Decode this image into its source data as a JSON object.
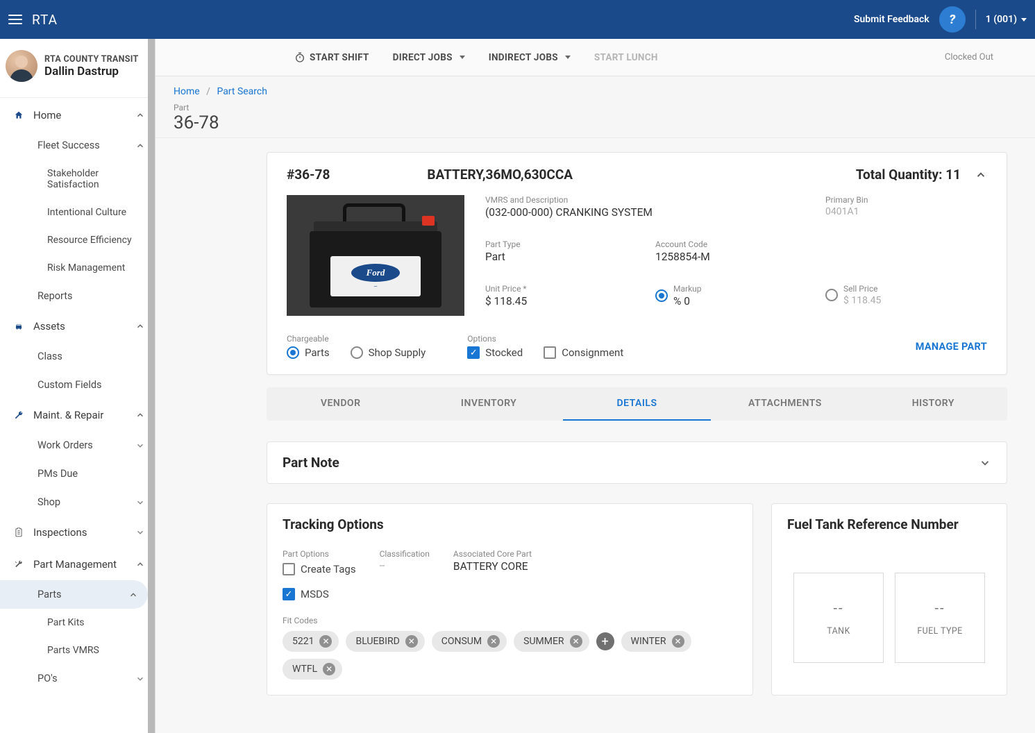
{
  "topbar": {
    "brand": "RTA",
    "feedback": "Submit Feedback",
    "user": "1 (001)"
  },
  "profile": {
    "org": "RTA COUNTY TRANSIT",
    "name": "Dallin Dastrup"
  },
  "sidebar": {
    "home": "Home",
    "fleet_success": "Fleet Success",
    "stakeholder": "Stakeholder Satisfaction",
    "intentional": "Intentional Culture",
    "resource": "Resource Efficiency",
    "risk": "Risk Management",
    "reports": "Reports",
    "assets": "Assets",
    "class": "Class",
    "custom_fields": "Custom Fields",
    "maint": "Maint. & Repair",
    "work_orders": "Work Orders",
    "pms_due": "PMs Due",
    "shop": "Shop",
    "inspections": "Inspections",
    "part_mgmt": "Part Management",
    "parts": "Parts",
    "part_kits": "Part Kits",
    "parts_vmrs": "Parts VMRS",
    "pos": "PO's"
  },
  "toolbar": {
    "start_shift": "START SHIFT",
    "direct_jobs": "DIRECT JOBS",
    "indirect_jobs": "INDIRECT JOBS",
    "start_lunch": "START LUNCH",
    "status": "Clocked Out"
  },
  "breadcrumb": {
    "home": "Home",
    "search": "Part Search"
  },
  "page": {
    "label": "Part",
    "title": "36-78"
  },
  "part": {
    "number": "#36-78",
    "title": "BATTERY,36MO,630CCA",
    "qty_label": "Total Quantity: ",
    "qty_value": "11",
    "vmrs_label": "VMRS and Description",
    "vmrs_value": "(032-000-000) CRANKING SYSTEM",
    "primary_bin_label": "Primary Bin",
    "primary_bin_value": "0401A1",
    "part_type_label": "Part Type",
    "part_type_value": "Part",
    "account_code_label": "Account Code",
    "account_code_value": "1258854-M",
    "unit_price_label": "Unit Price *",
    "unit_price_value": "$ 118.45",
    "markup_label": "Markup",
    "markup_value": "% 0",
    "sell_price_label": "Sell Price",
    "sell_price_value": "$ 118.45",
    "chargeable_label": "Chargeable",
    "chargeable_parts": "Parts",
    "chargeable_shop": "Shop Supply",
    "options_label": "Options",
    "options_stocked": "Stocked",
    "options_consign": "Consignment",
    "manage": "MANAGE PART",
    "image_brand": "Ford"
  },
  "tabs": {
    "vendor": "VENDOR",
    "inventory": "INVENTORY",
    "details": "DETAILS",
    "attachments": "ATTACHMENTS",
    "history": "HISTORY"
  },
  "panels": {
    "part_note": "Part Note",
    "tracking": "Tracking Options",
    "fuel": "Fuel Tank Reference Number"
  },
  "tracking": {
    "part_options": "Part Options",
    "create_tags": "Create Tags",
    "msds": "MSDS",
    "classification_label": "Classification",
    "classification_value": "--",
    "assoc_core_label": "Associated Core Part",
    "assoc_core_value": "BATTERY CORE",
    "fit_codes_label": "Fit Codes",
    "chips": [
      "5221",
      "BLUEBIRD",
      "CONSUM",
      "SUMMER",
      "WINTER",
      "WTFL"
    ]
  },
  "fuel": {
    "dash": "--",
    "tank": "TANK",
    "fuel_type": "FUEL TYPE"
  }
}
